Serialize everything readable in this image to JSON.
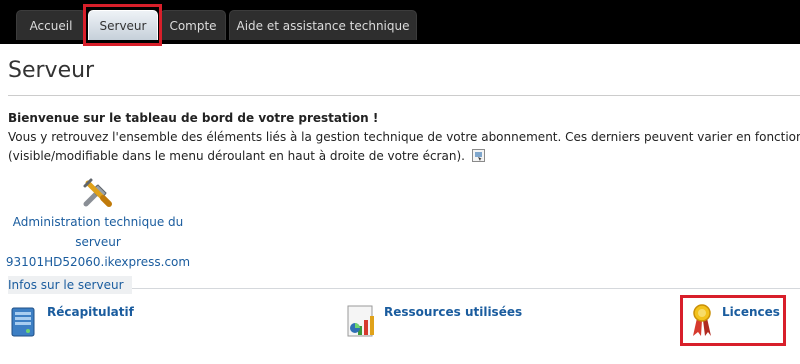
{
  "nav": {
    "tabs": [
      {
        "label": "Accueil"
      },
      {
        "label": "Serveur"
      },
      {
        "label": "Compte"
      },
      {
        "label": "Aide et assistance technique"
      }
    ]
  },
  "page": {
    "title": "Serveur",
    "welcome": "Bienvenue sur le tableau de bord de votre prestation !",
    "line2": "Vous y retrouvez l'ensemble des éléments liés à la gestion technique de votre abonnement. Ces derniers peuvent varier en fonction de l",
    "line3": "(visible/modifiable dans le menu déroulant en haut à droite de votre écran)."
  },
  "admin": {
    "label_line1": "Administration technique du",
    "label_line2": "serveur",
    "hostname": "93101HD52060.ikexpress.com",
    "icon": "tools-icon"
  },
  "section": {
    "label": "Infos sur le serveur",
    "links": [
      {
        "label": "Récapitulatif",
        "icon": "server-icon"
      },
      {
        "label": "Ressources utilisées",
        "icon": "chart-icon"
      },
      {
        "label": "Licences",
        "icon": "ribbon-icon"
      }
    ]
  },
  "colors": {
    "highlight": "#d81f2a",
    "link": "#1a5c9e"
  }
}
